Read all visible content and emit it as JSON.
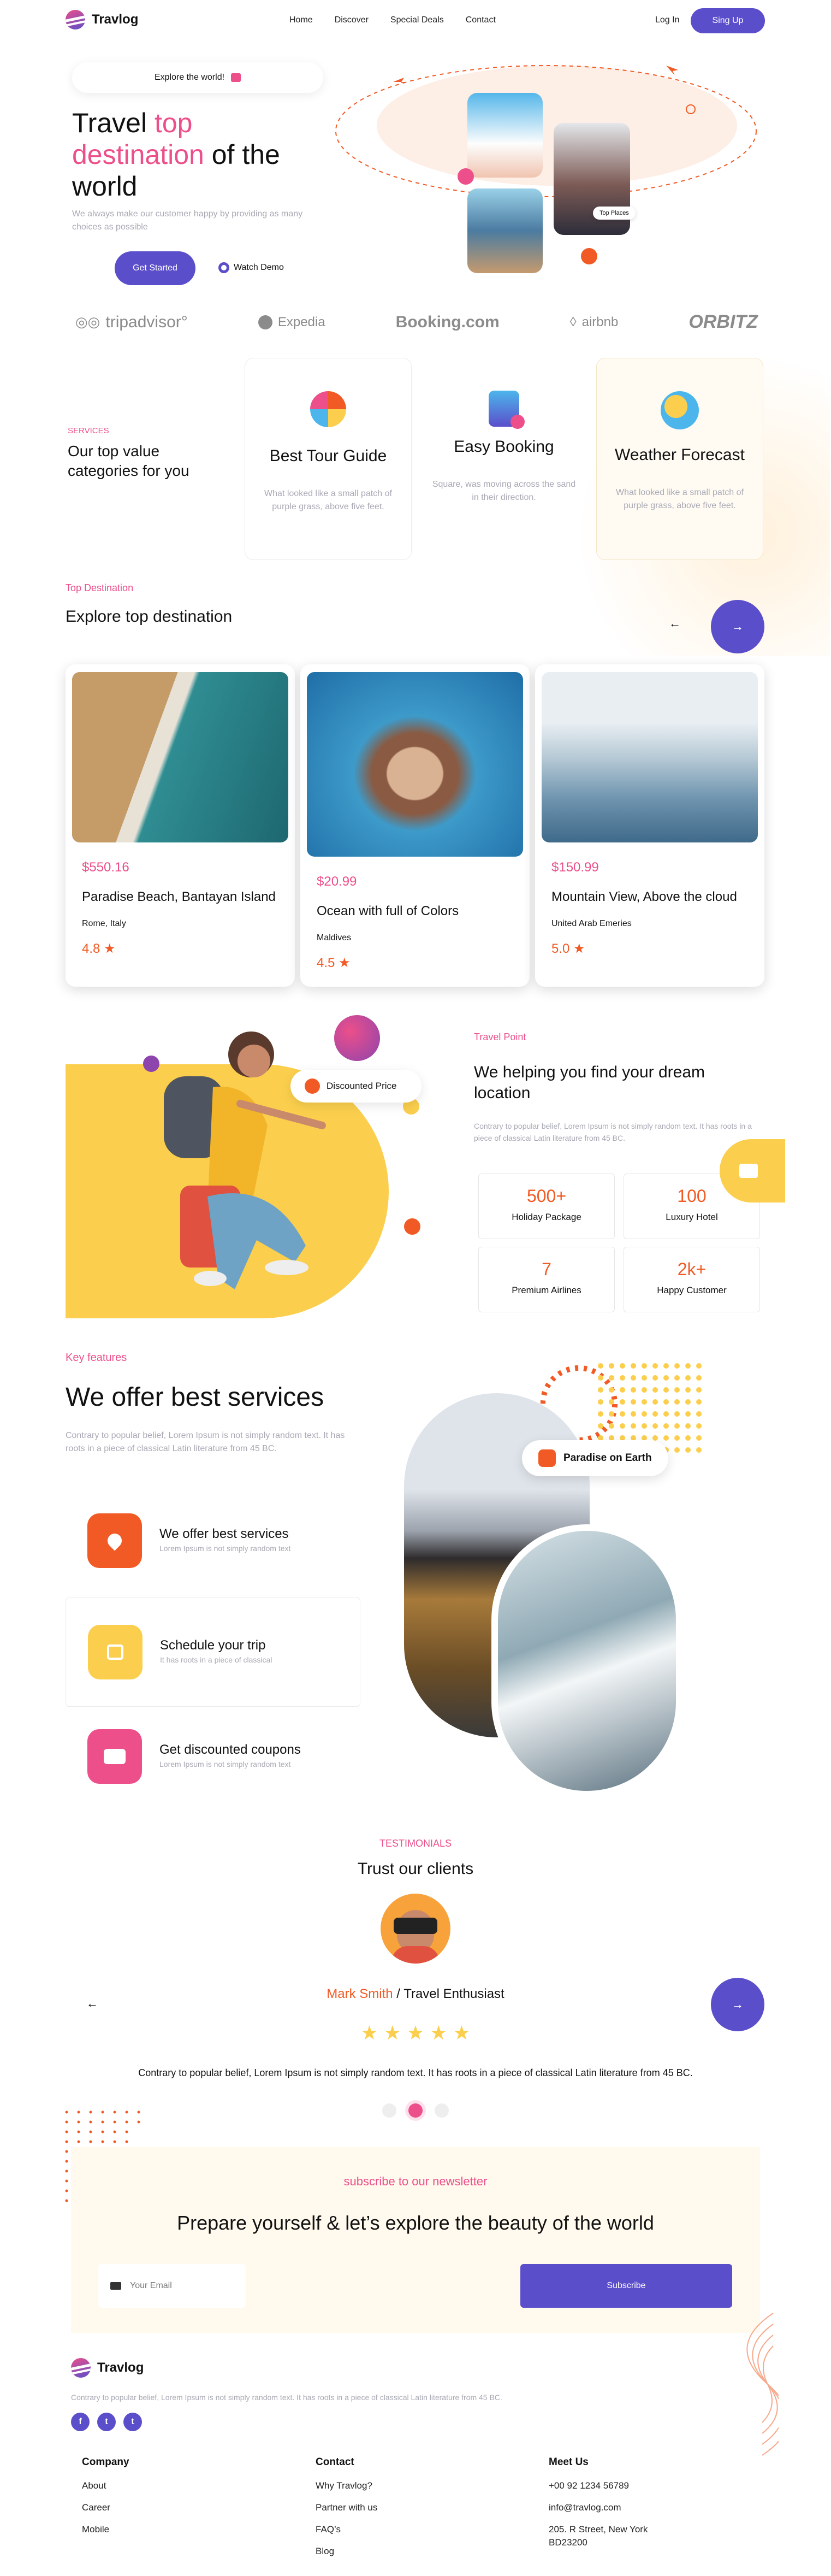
{
  "brand": {
    "name": "Travlog"
  },
  "nav": {
    "links": [
      "Home",
      "Discover",
      "Special Deals",
      "Contact"
    ],
    "login": "Log In",
    "signup": "Sing Up"
  },
  "hero": {
    "pill": "Explore the world!",
    "title_a": "Travel ",
    "title_b": "top",
    "title_c": "destination",
    "title_d": " of the",
    "title_e": "world",
    "desc": "We always make our customer happy by providing as many choices as possible",
    "cta": "Get Started",
    "watch": "Watch Demo",
    "top_places": "Top Places"
  },
  "partners": [
    "tripadvisor°",
    "Expedia",
    "Booking.com",
    "airbnb",
    "ORBITZ"
  ],
  "services": {
    "tag": "SERVICES",
    "title": "Our top value categories for you",
    "items": [
      {
        "title": "Best Tour Guide",
        "desc": "What looked like a small patch of purple grass, above five feet."
      },
      {
        "title": "Easy Booking",
        "desc": "Square, was moving across the sand in their direction."
      },
      {
        "title": "Weather Forecast",
        "desc": "What looked like a small patch of purple grass, above five feet."
      }
    ]
  },
  "destinations": {
    "tag": "Top Destination",
    "title": "Explore top destination",
    "cards": [
      {
        "price": "$550.16",
        "name": "Paradise Beach, Bantayan Island",
        "place": "Rome, Italy",
        "rating": "4.8"
      },
      {
        "price": "$20.99",
        "name": "Ocean with full of Colors",
        "place": "Maldives",
        "rating": "4.5"
      },
      {
        "price": "$150.99",
        "name": "Mountain View, Above the cloud",
        "place": "United Arab Emeries",
        "rating": "5.0"
      }
    ]
  },
  "travel_point": {
    "badge": "Discounted Price",
    "tag": "Travel Point",
    "title": "We helping you find your dream location",
    "desc": "Contrary to popular belief, Lorem Ipsum is not simply random text. It has roots in a piece of classical Latin literature from 45 BC.",
    "stats": [
      {
        "n": "500+",
        "l": "Holiday Package"
      },
      {
        "n": "100",
        "l": "Luxury Hotel"
      },
      {
        "n": "7",
        "l": "Premium Airlines"
      },
      {
        "n": "2k+",
        "l": "Happy Customer"
      }
    ]
  },
  "features": {
    "tag": "Key features",
    "title": "We offer best services",
    "desc": "Contrary to popular belief, Lorem Ipsum is not simply random text. It has roots in a piece of classical Latin literature from 45 BC.",
    "items": [
      {
        "title": "We offer best services",
        "desc": "Lorem Ipsum is not simply random text"
      },
      {
        "title": "Schedule your trip",
        "desc": "It has roots in a piece of classical"
      },
      {
        "title": "Get discounted coupons",
        "desc": "Lorem Ipsum is not simply random text"
      }
    ],
    "badge": "Paradise on Earth"
  },
  "testimonials": {
    "tag": "TESTIMONIALS",
    "title": "Trust our clients",
    "name": "Mark Smith",
    "role": " / Travel Enthusiast",
    "quote": "Contrary to popular belief, Lorem Ipsum is not simply random text. It has roots in a piece of classical Latin literature from 45 BC.",
    "stars": "★ ★ ★ ★ ★"
  },
  "newsletter": {
    "tag": "subscribe to our newsletter",
    "title": "Prepare yourself & let’s explore the beauty of the world",
    "placeholder": "Your Email",
    "button": "Subscribe"
  },
  "footer": {
    "desc": "Contrary to popular belief, Lorem Ipsum is not simply random text. It has roots in a piece of classical Latin literature from 45 BC.",
    "cols": [
      {
        "h": "Company",
        "links": [
          "About",
          "Career",
          "Mobile"
        ]
      },
      {
        "h": "Contact",
        "links": [
          "Why Travlog?",
          "Partner with us",
          "FAQ’s",
          "Blog"
        ]
      },
      {
        "h": "Meet Us",
        "links": [
          "+00 92 1234 56789",
          "info@travlog.com",
          "205. R Street, New York",
          "BD23200"
        ]
      }
    ]
  },
  "colors": {
    "accent": "#5b4ecb",
    "pink": "#ec4f8a",
    "orange": "#f15a24",
    "yellow": "#fbcf4d"
  }
}
